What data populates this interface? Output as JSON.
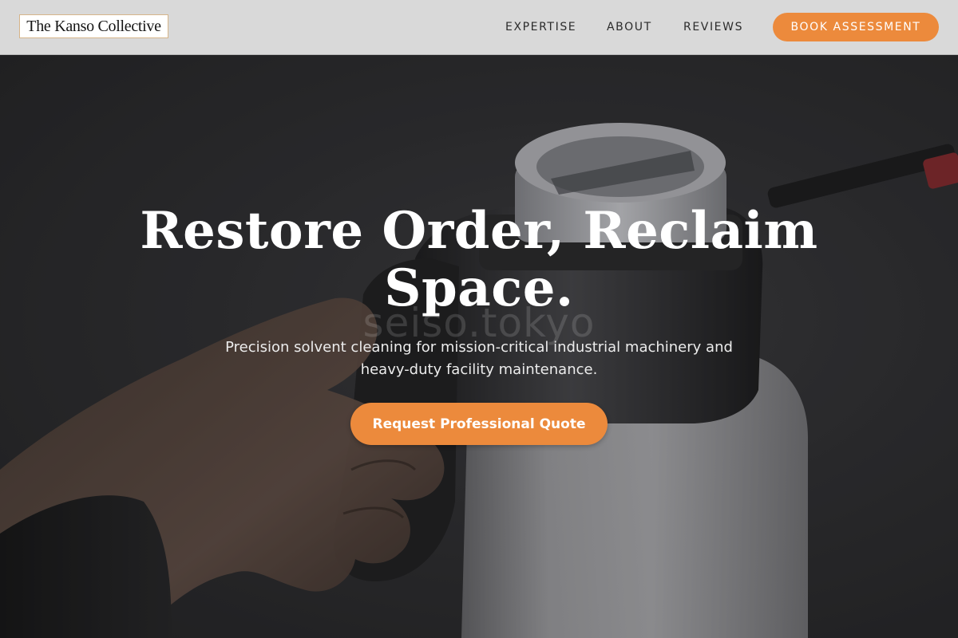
{
  "header": {
    "logo_text": "The Kanso Collective",
    "nav": [
      {
        "label": "EXPERTISE"
      },
      {
        "label": "ABOUT"
      },
      {
        "label": "REVIEWS"
      }
    ],
    "cta_label": "BOOK ASSESSMENT"
  },
  "hero": {
    "title": "Restore Order, Reclaim Space.",
    "subtitle": "Precision solvent cleaning for mission-critical industrial machinery and heavy-duty facility maintenance.",
    "cta_label": "Request Professional Quote",
    "watermark": "seiso.tokyo",
    "image_subject": "hand-holding-pump-sprayer"
  },
  "colors": {
    "accent": "#ec8a3c",
    "header_bg": "#d9d9d9",
    "hero_bg": "#2a2a2c",
    "text_light": "#ffffff"
  }
}
